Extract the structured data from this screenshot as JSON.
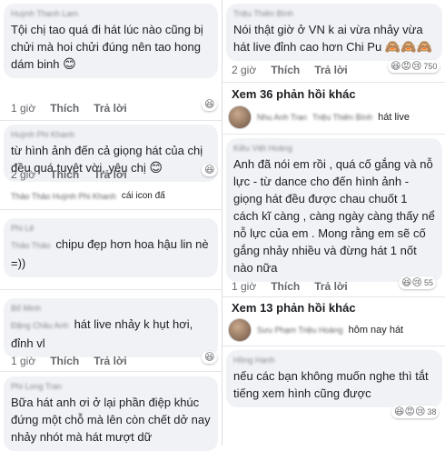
{
  "left": {
    "comments": [
      {
        "author": "Huỳnh Thanh Lam",
        "text": "Tội chị tao quá đi hát lúc nào cũng bị chửi mà hoi chửi đúng nên tao hong dám binh",
        "emoji": "😊",
        "time": "1 giờ",
        "like": "Thích",
        "reply": "Trả lời",
        "reactions": [
          "😆"
        ]
      },
      {
        "author": "Huỳnh Phi Khanh",
        "text": "từ hình ảnh đến cả giọng hát của chị đều quá tuyệt vời, yêu chị",
        "emoji": "😊",
        "time": "2 giờ",
        "like": "Thích",
        "reply": "Trả lời",
        "reactions": [
          "😆"
        ]
      },
      {
        "author": "Thảo Thảo Huỳnh Phi Khanh",
        "text": "cái icon đấ",
        "emoji": "",
        "time": "",
        "like": "",
        "reply": "",
        "reactions": []
      },
      {
        "author": "Phi Lê",
        "inline_author": "Thảo Thảo",
        "text": "chipu đẹp hơn hoa hậu lin nè =))",
        "emoji": "",
        "time": "",
        "like": "",
        "reply": "",
        "reactions": []
      },
      {
        "author": "Bố Minh",
        "inline_author": "Đặng Châu Anh",
        "text": "hát live nhảy k hụt hơi, đỉnh vl",
        "emoji": "",
        "time": "1 giờ",
        "like": "Thích",
        "reply": "Trả lời",
        "reactions": [
          "😆"
        ]
      },
      {
        "author": "Phi Long Tran",
        "text": "Bữa hát anh ơi ở lại phần điệp khúc đứng một chỗ mà lên còn chết dở nay nhảy nhót mà hát mượt dữ",
        "emoji": "",
        "time": "",
        "like": "",
        "reply": "",
        "reactions": []
      }
    ]
  },
  "right": {
    "top_comment": {
      "author": "Triệu Thiên Bình",
      "text": "Nói thật giờ ở VN k ai vừa nhảy vừa hát live đỉnh cao hơn Chi Pu",
      "emoji": "🙈🙈🙈",
      "time": "2 giờ",
      "like": "Thích",
      "reply": "Trả lời",
      "reactions": [
        "😆",
        "😡",
        "😢"
      ],
      "reaction_count": "750"
    },
    "more_1": "Xem 36 phản hồi khác",
    "mini_1": {
      "name": "Nhu Anh Tran",
      "blurred": "Triệu Thiên Bình",
      "snippet": "hát live"
    },
    "long_comment": {
      "author": "Kiều Việt Hoàng",
      "text": "Anh đã nói em rồi , quá cố gắng và nỗ lực - từ dance cho đến hình ảnh - giọng hát đều được chau chuốt 1 cách kĩ càng , càng ngày càng thấy nể nỗ lực của em . Mong rằng em sẽ cố gắng nhảy nhiều và đừng hát 1 nốt nào nữa",
      "time": "1 giờ",
      "like": "Thích",
      "reply": "Trả lời",
      "reactions": [
        "😆",
        "😢"
      ],
      "reaction_count": "55"
    },
    "more_2": "Xem 13 phản hồi khác",
    "mini_2": {
      "name": "Sưu Phạm Triệu Hoàng",
      "snippet": "hôm nay hát"
    },
    "last_comment": {
      "author": "Hồng Hạnh",
      "text": "nếu các bạn không muốn nghe thì tắt tiếng xem hình cũng được",
      "reactions": [
        "😆",
        "😡",
        "😢"
      ],
      "reaction_count": "38"
    }
  }
}
